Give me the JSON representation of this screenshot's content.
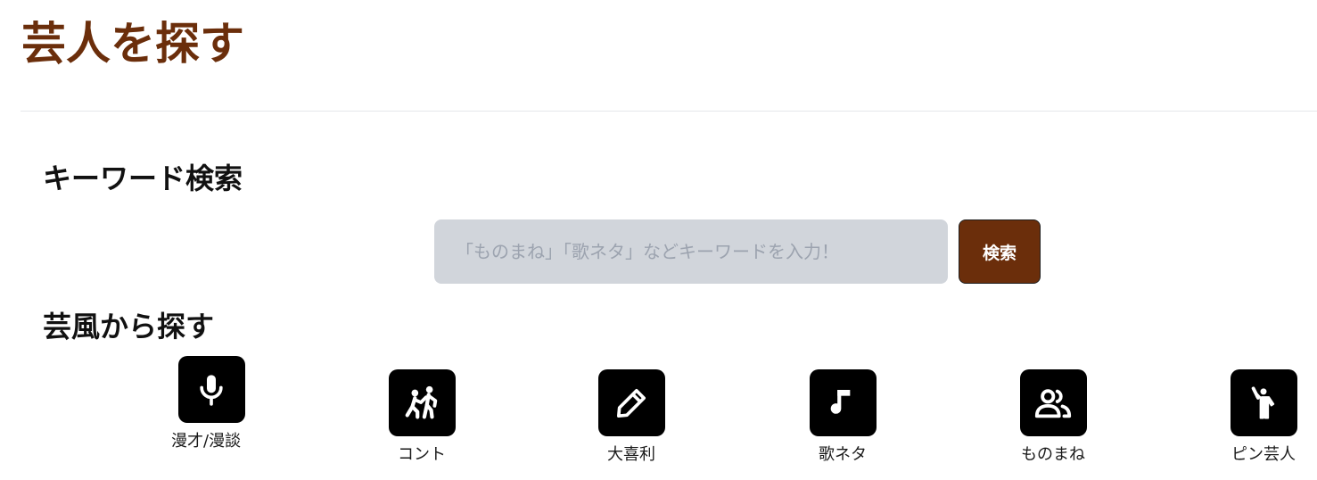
{
  "page": {
    "title": "芸人を探す"
  },
  "keyword_search": {
    "heading": "キーワード検索",
    "placeholder": "「ものまね」「歌ネタ」などキーワードを入力！",
    "value": "",
    "button_label": "検索"
  },
  "style_search": {
    "heading": "芸風から探す",
    "genres": [
      {
        "label": "漫才/漫談",
        "icon": "microphone-icon"
      },
      {
        "label": "コント",
        "icon": "people-scuffle-icon"
      },
      {
        "label": "大喜利",
        "icon": "pencil-icon"
      },
      {
        "label": "歌ネタ",
        "icon": "music-note-icon"
      },
      {
        "label": "ものまね",
        "icon": "people-icon"
      },
      {
        "label": "ピン芸人",
        "icon": "person-waving-icon"
      }
    ]
  },
  "colors": {
    "accent": "#6b2e0b",
    "input_background": "#d1d5db",
    "icon_tile": "#000000"
  }
}
